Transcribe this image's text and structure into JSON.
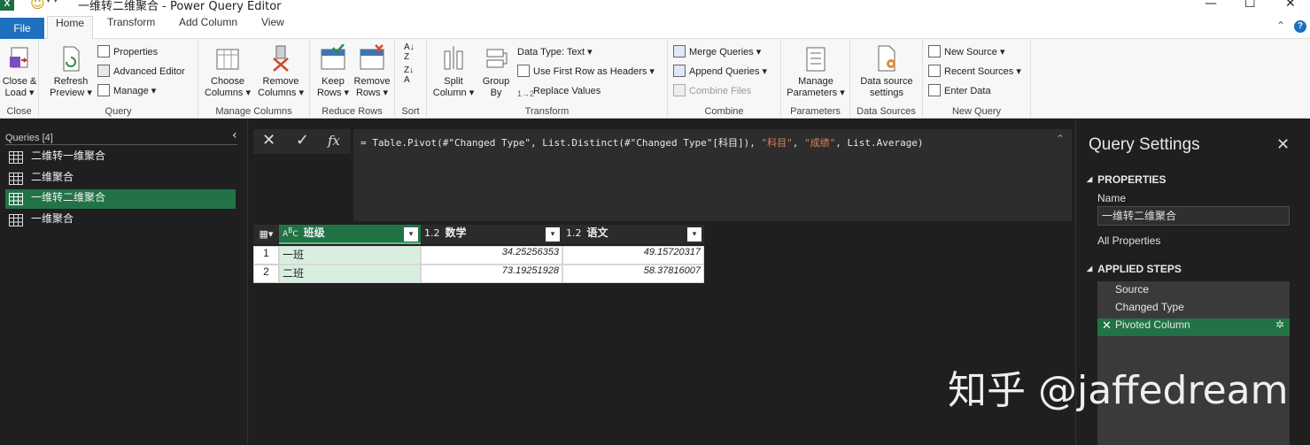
{
  "window": {
    "title": "一维转二维聚合 - Power Query Editor",
    "minimize": "—",
    "maximize": "☐",
    "close": "✕"
  },
  "tabs": {
    "file": "File",
    "home": "Home",
    "transform": "Transform",
    "add_column": "Add Column",
    "view": "View"
  },
  "ribbon": {
    "close_group": {
      "label": "Close",
      "close_load": "Close &",
      "close_load2": "Load ▾"
    },
    "query_group": {
      "label": "Query",
      "refresh": "Refresh",
      "refresh2": "Preview ▾",
      "properties": "Properties",
      "advanced_editor": "Advanced Editor",
      "manage": "Manage ▾"
    },
    "manage_columns": {
      "label": "Manage Columns",
      "choose": "Choose",
      "choose2": "Columns ▾",
      "remove": "Remove",
      "remove2": "Columns ▾"
    },
    "reduce_rows": {
      "label": "Reduce Rows",
      "keep": "Keep",
      "keep2": "Rows ▾",
      "remove": "Remove",
      "remove2": "Rows ▾"
    },
    "sort": {
      "label": "Sort"
    },
    "transform": {
      "label": "Transform",
      "split": "Split",
      "split2": "Column ▾",
      "group": "Group",
      "group2": "By",
      "data_type": "Data Type: Text ▾",
      "first_row": "Use First Row as Headers ▾",
      "replace": "Replace Values"
    },
    "combine": {
      "label": "Combine",
      "merge": "Merge Queries ▾",
      "append": "Append Queries ▾",
      "combine_files": "Combine Files"
    },
    "parameters": {
      "label": "Parameters",
      "manage": "Manage",
      "manage2": "Parameters ▾"
    },
    "data_sources": {
      "label": "Data Sources",
      "settings": "Data source",
      "settings2": "settings"
    },
    "new_query": {
      "label": "New Query",
      "new_source": "New Source ▾",
      "recent": "Recent Sources ▾",
      "enter": "Enter Data"
    }
  },
  "queries": {
    "header": "Queries [4]",
    "items": [
      {
        "label": "二维转一维聚合"
      },
      {
        "label": "二维聚合"
      },
      {
        "label": "一维转二维聚合"
      },
      {
        "label": "一维聚合"
      }
    ]
  },
  "formula": {
    "prefix": "= Table.Pivot(#\"Changed Type\", List.Distinct(#\"Changed Type\"[科目]), ",
    "str1": "\"科目\"",
    "mid": ", ",
    "str2": "\"成绩\"",
    "suffix": ", List.Average)"
  },
  "grid": {
    "columns": [
      {
        "type": "A B C",
        "name": "班级"
      },
      {
        "type": "1.2",
        "name": "数学"
      },
      {
        "type": "1.2",
        "name": "语文"
      }
    ],
    "rows": [
      {
        "num": "1",
        "cls": "一班",
        "math": "34.25256353",
        "chinese": "49.15720317"
      },
      {
        "num": "2",
        "cls": "二班",
        "math": "73.19251928",
        "chinese": "58.37816007"
      }
    ]
  },
  "settings": {
    "title": "Query Settings",
    "properties": "PROPERTIES",
    "name_label": "Name",
    "name_value": "一维转二维聚合",
    "all_properties": "All Properties",
    "applied_steps": "APPLIED STEPS",
    "steps": [
      "Source",
      "Changed Type",
      "Pivoted Column"
    ]
  },
  "watermark": "知乎 @jaffedream",
  "colors": {
    "excel_green": "#217346",
    "file_blue": "#1f6fbf",
    "dark_bg": "#1f1f1f"
  }
}
